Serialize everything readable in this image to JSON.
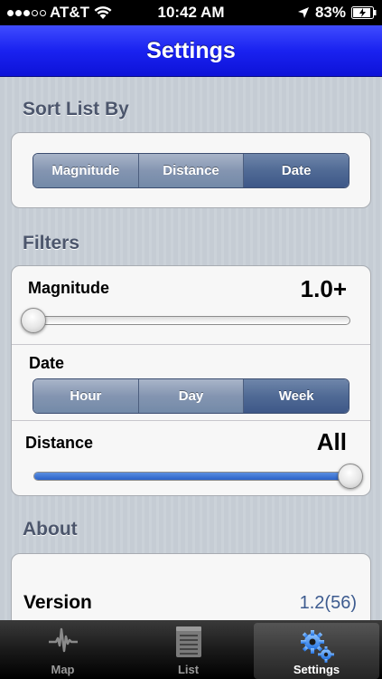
{
  "status_bar": {
    "carrier": "AT&T",
    "time": "10:42 AM",
    "battery": "83%"
  },
  "nav": {
    "title": "Settings"
  },
  "sort": {
    "header": "Sort List By",
    "options": [
      "Magnitude",
      "Distance",
      "Date"
    ],
    "selected": "Date"
  },
  "filters": {
    "header": "Filters",
    "magnitude": {
      "label": "Magnitude",
      "value": "1.0+",
      "slider_fraction": 0.0
    },
    "date": {
      "label": "Date",
      "options": [
        "Hour",
        "Day",
        "Week"
      ],
      "selected": "Week"
    },
    "distance": {
      "label": "Distance",
      "value": "All",
      "slider_fraction": 1.0
    }
  },
  "about": {
    "header": "About",
    "version_label": "Version",
    "version_value": "1.2(56)"
  },
  "tabs": [
    {
      "label": "Map",
      "icon": "seismograph-icon",
      "selected": false
    },
    {
      "label": "List",
      "icon": "list-icon",
      "selected": false
    },
    {
      "label": "Settings",
      "icon": "gears-icon",
      "selected": true
    }
  ],
  "colors": {
    "nav_blue": "#1a22f0",
    "segment_selected": "#506a95",
    "version_blue": "#3d5b8f"
  }
}
